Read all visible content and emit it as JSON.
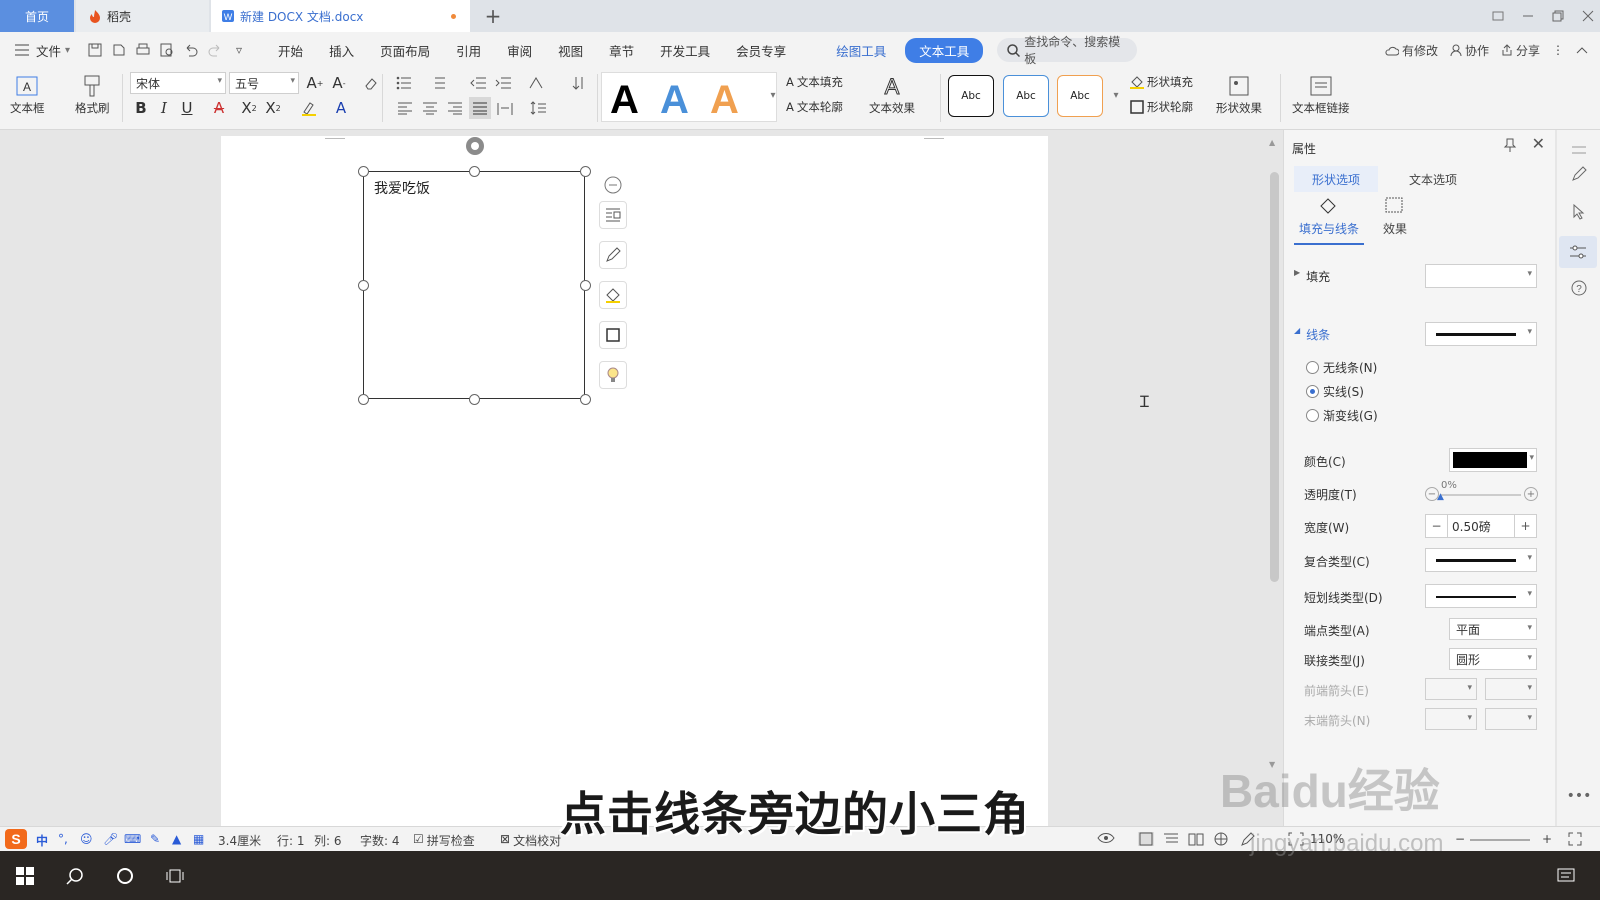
{
  "tabs": {
    "home": "首页",
    "daoke": "稻壳",
    "doc": "新建 DOCX 文档.docx",
    "add": "+"
  },
  "menu": {
    "file": "文件",
    "items": [
      "开始",
      "插入",
      "页面布局",
      "引用",
      "审阅",
      "视图",
      "章节",
      "开发工具",
      "会员专享"
    ],
    "draw_tools": "绘图工具",
    "text_tools": "文本工具",
    "search": "查找命令、搜索模板",
    "modified": "有修改",
    "collab": "协作",
    "share": "分享"
  },
  "ribbon": {
    "textbox": "文本框",
    "format_painter": "格式刷",
    "font": "宋体",
    "size": "五号",
    "text_fill": "文本填充",
    "text_outline": "文本轮廓",
    "text_effect": "文本效果",
    "style_label": "Abc",
    "shape_fill": "形状填充",
    "shape_outline": "形状轮廓",
    "shape_effect": "形状效果",
    "textbox_link": "文本框链接",
    "colors": {
      "black": "#000000",
      "blue": "#4a90d9",
      "orange": "#f0a050"
    }
  },
  "document": {
    "textbox_text": "我爱吃饭"
  },
  "panel": {
    "title": "属性",
    "tab_shape": "形状选项",
    "tab_text": "文本选项",
    "sub_fill": "填充与线条",
    "sub_effect": "效果",
    "fill": "填充",
    "line": "线条",
    "radio_none": "无线条(N)",
    "radio_solid": "实线(S)",
    "radio_gradient": "渐变线(G)",
    "color_label": "颜色(C)",
    "color_value": "#000000",
    "transparency_label": "透明度(T)",
    "transparency_value": "0%",
    "width_label": "宽度(W)",
    "width_value": "0.50磅",
    "compound_label": "复合类型(C)",
    "dash_label": "短划线类型(D)",
    "cap_label": "端点类型(A)",
    "cap_value": "平面",
    "join_label": "联接类型(J)",
    "join_value": "圆形",
    "begin_arrow_label": "前端箭头(E)",
    "end_arrow_label": "末端箭头(N)"
  },
  "status": {
    "ime": "中",
    "position": "3.4厘米",
    "row": "行: 1",
    "col": "列: 6",
    "words": "字数: 4",
    "spell": "拼写检查",
    "proof": "文档校对",
    "zoom": "110%"
  },
  "overlay": {
    "subtitle": "点击线条旁边的小三角",
    "watermark": "Baidu经验",
    "watermark_url": "jingyan.baidu.com"
  }
}
